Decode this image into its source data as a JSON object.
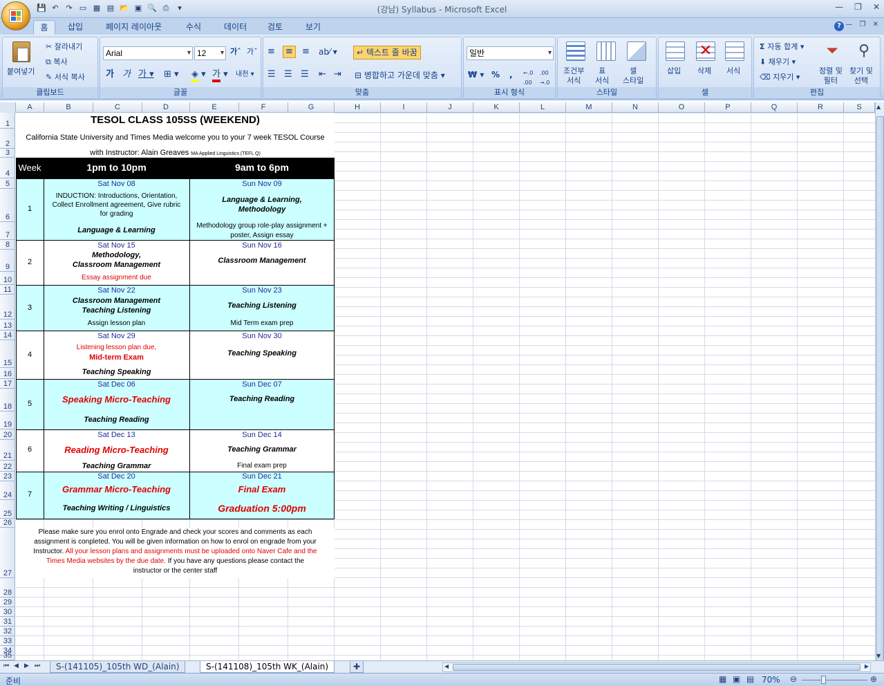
{
  "window": {
    "title": "(강남) Syllabus  -  Microsoft Excel"
  },
  "tabs": [
    "홈",
    "삽입",
    "페이지 레이아웃",
    "수식",
    "데이터",
    "검토",
    "보기"
  ],
  "ribbon": {
    "clipboard": {
      "label": "클립보드",
      "paste": "붙여넣기",
      "cut": "잘라내기",
      "copy": "복사",
      "format_painter": "서식 복사"
    },
    "font": {
      "label": "글꼴",
      "name": "Arial",
      "size": "12"
    },
    "alignment": {
      "label": "맞춤",
      "wrap": "텍스트 줄 바꿈",
      "merge": "병합하고 가운데 맞춤"
    },
    "number": {
      "label": "표시 형식",
      "format": "일반"
    },
    "styles": {
      "label": "스타일",
      "conditional": "조건부\n서식",
      "table": "표\n서식",
      "cell": "셀\n스타일"
    },
    "cells": {
      "label": "셀",
      "insert": "삽입",
      "delete": "삭제",
      "format": "서식"
    },
    "editing": {
      "label": "편집",
      "autosum": "자동 합계",
      "fill": "채우기",
      "clear": "지우기",
      "sort": "정렬 및\n필터",
      "find": "찾기 및\n선택"
    }
  },
  "columns": [
    "A",
    "B",
    "C",
    "D",
    "E",
    "F",
    "G",
    "H",
    "I",
    "J",
    "K",
    "L",
    "M",
    "N",
    "O",
    "P",
    "Q",
    "R",
    "S"
  ],
  "rows": [
    "1",
    "2",
    "3",
    "4",
    "5",
    "6",
    "7",
    "8",
    "9",
    "10",
    "11",
    "12",
    "13",
    "14",
    "15",
    "16",
    "17",
    "18",
    "19",
    "20",
    "21",
    "22",
    "23",
    "24",
    "25",
    "26",
    "27",
    "28",
    "29",
    "30",
    "31",
    "32",
    "33",
    "34",
    "35"
  ],
  "sheet": {
    "title": "TESOL CLASS 105SS (WEEKEND)",
    "subtitle": "California State University and Times Media welcome you to your 7 week TESOL Course",
    "instructor": "with Instructor: Alain Greaves",
    "instructor_note": "MA Applied Linguistics (TEFL Q)",
    "header": {
      "week": "Week",
      "sat": "1pm to 10pm",
      "sun": "9am to 6pm"
    },
    "weeks": [
      {
        "num": "1",
        "sat_date": "Sat Nov 08",
        "sat_a": "INDUCTION:   Introductions, Orientation,",
        "sat_b": "Collect Enrollment agreement, Give rubric",
        "sat_c": "for grading",
        "sat_d": "Language & Learning",
        "sun_date": "Sun Nov 09",
        "sun_a": "Language & Learning,",
        "sun_b": "Methodology",
        "sun_c": "Methodology group role-play assignment +",
        "sun_d": "poster, Assign essay"
      },
      {
        "num": "2",
        "sat_date": "Sat Nov 15",
        "sat_a": "Methodology,",
        "sat_b": "Classroom Management",
        "sat_c": "Essay assignment due",
        "sun_date": "Sun Nov 16",
        "sun_a": "Classroom Management"
      },
      {
        "num": "3",
        "sat_date": "Sat Nov 22",
        "sat_a": "Classroom Management",
        "sat_b": "Teaching Listening",
        "sat_c": "Assign lesson plan",
        "sun_date": "Sun Nov 23",
        "sun_a": "Teaching Listening",
        "sun_b": "Mid Term exam prep"
      },
      {
        "num": "4",
        "sat_date": "Sat Nov 29",
        "sat_a": "Listening lesson plan due,",
        "sat_b": "Mid-term Exam",
        "sat_c": "Teaching Speaking",
        "sun_date": "Sun Nov 30",
        "sun_a": "Teaching Speaking"
      },
      {
        "num": "5",
        "sat_date": "Sat Dec 06",
        "sat_a": "Speaking Micro-Teaching",
        "sat_b": "Teaching Reading",
        "sun_date": "Sun Dec 07",
        "sun_a": "Teaching Reading"
      },
      {
        "num": "6",
        "sat_date": "Sat Dec 13",
        "sat_a": "Reading Micro-Teaching",
        "sat_b": "Teaching Grammar",
        "sun_date": "Sun Dec 14",
        "sun_a": "Teaching Grammar",
        "sun_b": "Final exam prep"
      },
      {
        "num": "7",
        "sat_date": "Sat Dec 20",
        "sat_a": "Grammar Micro-Teaching",
        "sat_b": "Teaching Writing / Linguistics",
        "sun_date": "Sun Dec 21",
        "sun_a": "Final Exam",
        "sun_b": "Graduation 5:00pm"
      }
    ],
    "footer": {
      "l1": "Please make sure you enrol onto Engrade and check your scores and comments as each",
      "l2": "assignment is conpleted.  You will be given information on how to enrol on engrade from your",
      "l3a": "Instructor. ",
      "l3b": "All your lesson plans and assignments must be uploaded onto Naver Cafe and the",
      "l4a": "Times Media websites by the due date.",
      "l4b": "  If you have any questions please contact the",
      "l5": "instructor or the center staff"
    }
  },
  "sheet_tabs": [
    "S-(141105)_105th WD_(Alain)",
    "S-(141108)_105th WK_(Alain)"
  ],
  "status": {
    "ready": "준비",
    "zoom": "70%"
  }
}
